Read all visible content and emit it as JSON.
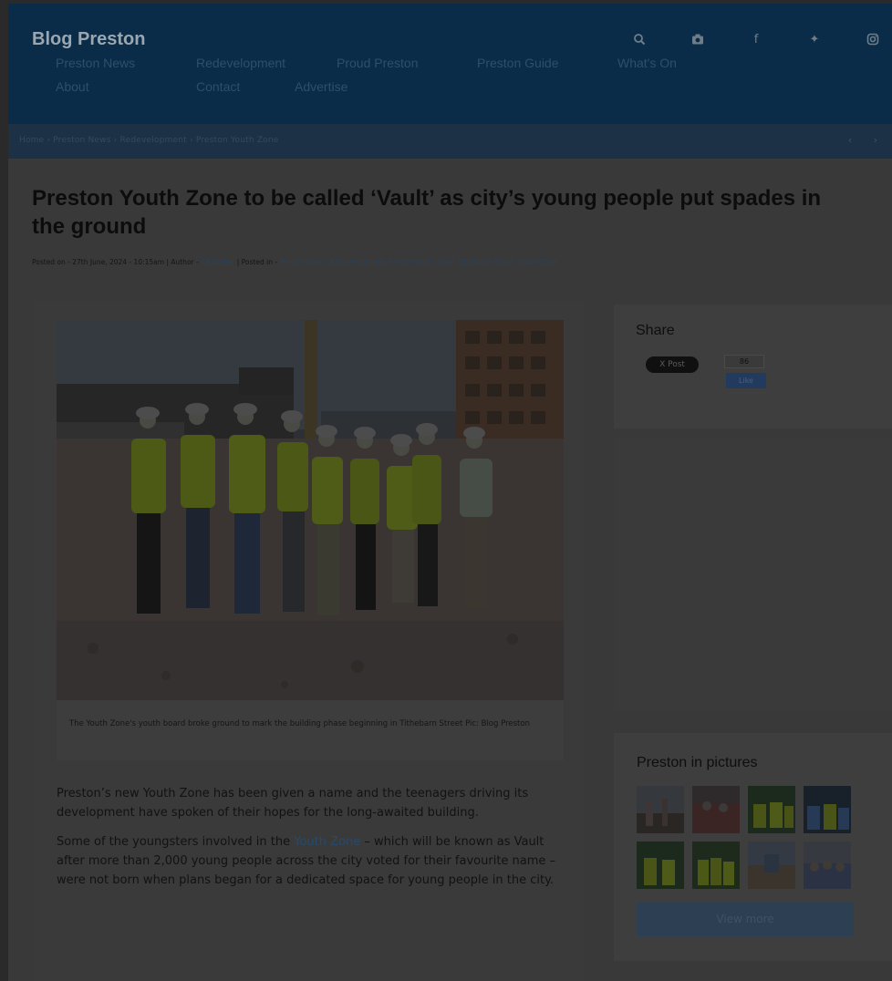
{
  "header": {
    "brand": "Blog Preston",
    "nav": [
      "Preston News",
      "Redevelopment",
      "Proud Preston",
      "Preston Guide",
      "What's On",
      "About",
      "Contact",
      "Advertise"
    ],
    "icons": [
      "search-icon",
      "camera-icon",
      "facebook-icon",
      "twitter-icon",
      "instagram-icon"
    ],
    "icon_glyphs": {
      "facebook": "f",
      "twitter": "✦"
    }
  },
  "breadcrumb": {
    "text": "Home › Preston News › Redevelopment › Preston Youth Zone",
    "nav_glyph": "‹ ›"
  },
  "article": {
    "title": "Preston Youth Zone to be called ‘Vault’ as city’s young people put spades in the ground",
    "meta_prefix": "Posted on - 27th June, 2024 - 10:15am | Author -",
    "meta_author": "Ed Walker",
    "meta_mid": "| Posted in -",
    "meta_categories": "Preston News, Redevelopment, Preston Youth Zone, Tithebarn Street, Youth Zone",
    "caption": "The Youth Zone's youth board broke ground to mark the building phase beginning in Tithebarn Street Pic: Blog Preston",
    "paragraphs": [
      {
        "text": "Preston’s new Youth Zone has been given a name and the teenagers driving its development have spoken of their hopes for the long-awaited building."
      },
      {
        "pre": "Some of the youngsters involved in the ",
        "link": "Youth Zone",
        "post": " – which will be known as Vault after more than 2,000 young people across the city voted for their favourite name – were not born when plans began for a dedicated space for young people in the city."
      }
    ]
  },
  "sidebar": {
    "share_title": "Share",
    "x_post_label": "X Post",
    "fb_count": "86",
    "fb_like_label": "Like",
    "pictures_title": "Preston in pictures",
    "view_more_label": "View more"
  },
  "colors": {
    "header_bg": "#0a2c48",
    "breadcrumb_bg": "#1c3146",
    "page_bg": "#393939",
    "link": "#274a6c",
    "button": "#2d3f52"
  }
}
